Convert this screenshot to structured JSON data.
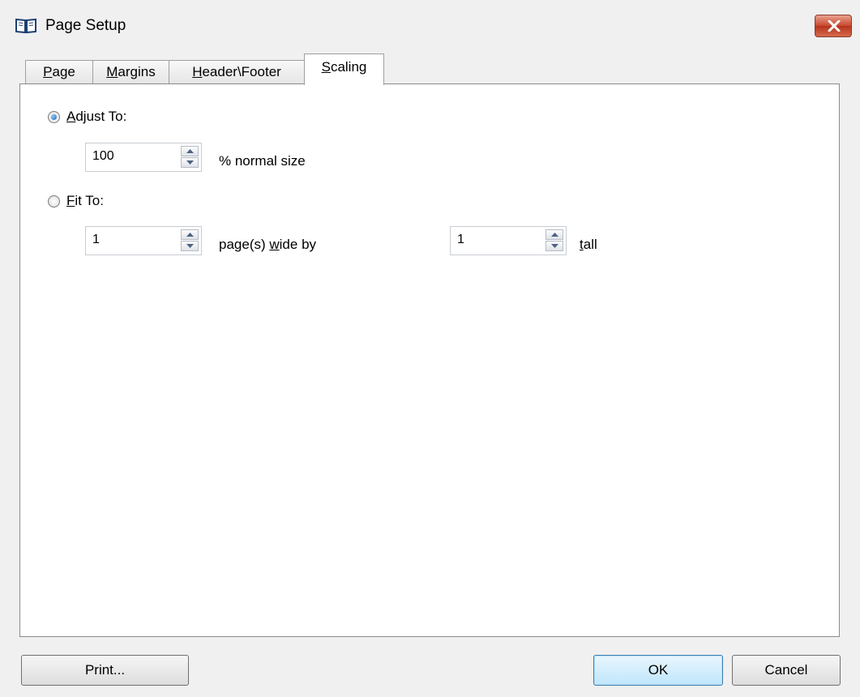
{
  "window": {
    "title": "Page Setup"
  },
  "tabs": [
    {
      "label_u": "P",
      "label_rest": "age",
      "active": false
    },
    {
      "label_u": "M",
      "label_rest": "argins",
      "active": false
    },
    {
      "label_u": "H",
      "label_rest": "eader\\Footer",
      "active": false
    },
    {
      "label_u": "S",
      "label_rest": "caling",
      "active": true
    }
  ],
  "scaling": {
    "adjust_to": {
      "label_u": "A",
      "label_rest": "djust To:",
      "selected": true,
      "value": "100",
      "suffix": "% normal size"
    },
    "fit_to": {
      "label_u": "F",
      "label_rest": "it To:",
      "selected": false,
      "wide_value": "1",
      "wide_label_pre": "page(s) ",
      "wide_label_u": "w",
      "wide_label_post": "ide by",
      "tall_value": "1",
      "tall_label_u": "t",
      "tall_label_rest": "all"
    }
  },
  "buttons": {
    "print": "Print...",
    "ok": "OK",
    "cancel": "Cancel"
  },
  "colors": {
    "close_button": "#c8472f",
    "radio_selected": "#1a5fb4",
    "background": "#f0f0f0"
  }
}
